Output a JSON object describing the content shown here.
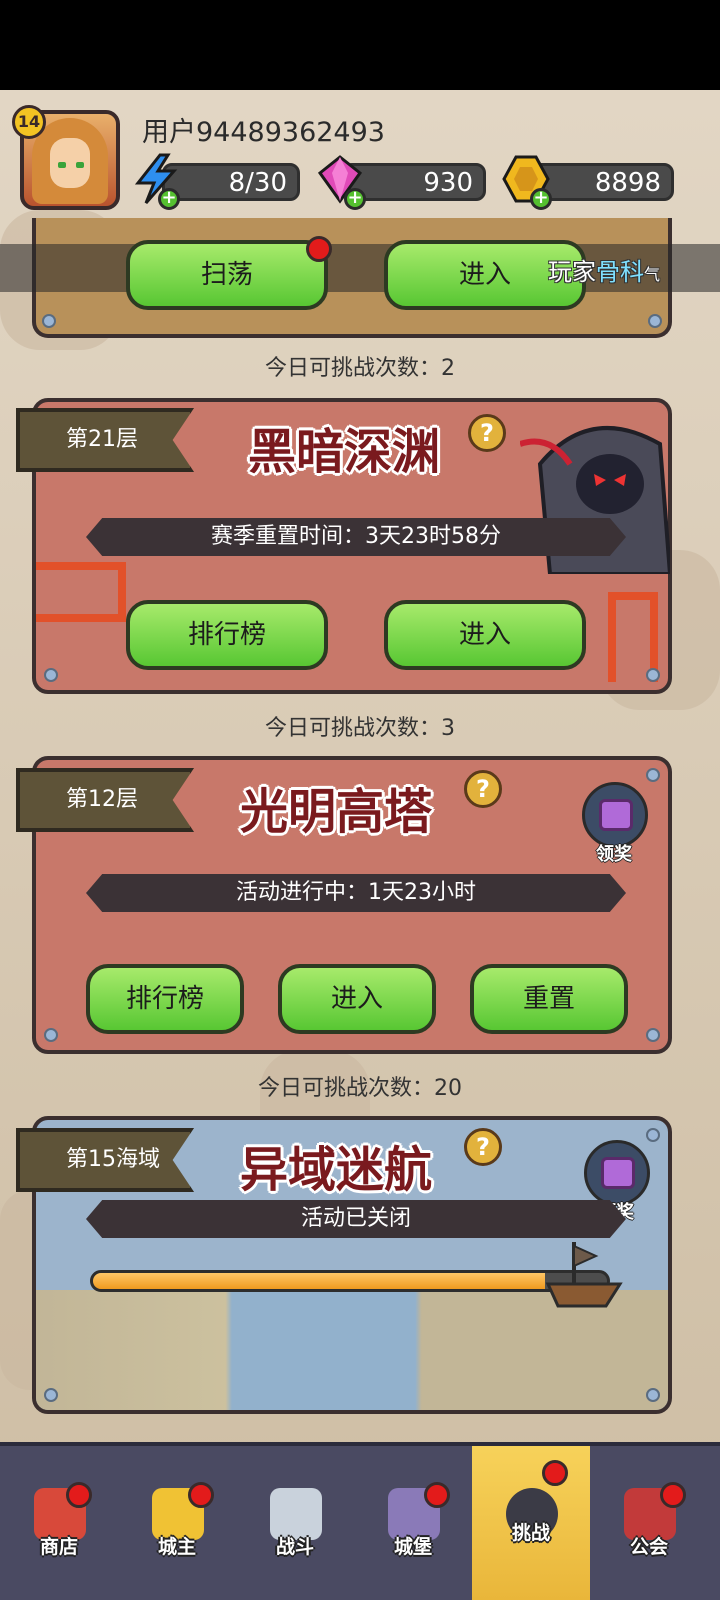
{
  "header": {
    "level": "14",
    "username": "用户94489362493",
    "energy": "8/30",
    "gems": "930",
    "coins": "8898"
  },
  "overlay_text": {
    "prefix": "玩家",
    "highlight": "骨科",
    "suffix": "气"
  },
  "top_card": {
    "sweep_label": "扫荡",
    "enter_label": "进入",
    "count_text": "今日可挑战次数：2"
  },
  "abyss": {
    "floor": "第21层",
    "title": "黑暗深渊",
    "info": "赛季重置时间：3天23时58分",
    "rank_label": "排行榜",
    "enter_label": "进入",
    "count_text": "今日可挑战次数：3"
  },
  "tower": {
    "floor": "第12层",
    "title": "光明高塔",
    "info": "活动进行中：1天23小时",
    "reward_label": "领奖",
    "rank_label": "排行榜",
    "enter_label": "进入",
    "reset_label": "重置",
    "count_text": "今日可挑战次数：20"
  },
  "voyage": {
    "floor": "第15海域",
    "title": "异域迷航",
    "info": "活动已关闭",
    "reward_label": "领奖",
    "progress": 0.88
  },
  "nav": {
    "items": [
      {
        "label": "商店"
      },
      {
        "label": "城主"
      },
      {
        "label": "战斗"
      },
      {
        "label": "城堡"
      },
      {
        "label": "挑战"
      },
      {
        "label": "公会"
      }
    ]
  },
  "colors": {
    "accent_green": "#58c733",
    "active_tab": "#f7d25a",
    "badge_red": "#e31b1b"
  }
}
